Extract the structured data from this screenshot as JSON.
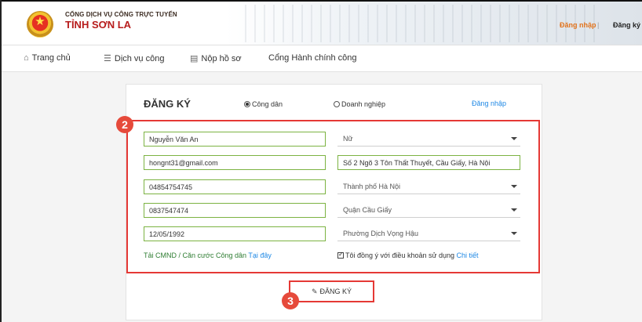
{
  "header": {
    "brand_line1": "CỔNG DỊCH VỤ CÔNG TRỰC TUYẾN",
    "brand_line2": "TỈNH SƠN LA",
    "login": "Đăng nhập",
    "separator": "|",
    "register": "Đăng ký"
  },
  "nav": [
    {
      "label": "Trang chủ",
      "icon": "home-icon",
      "glyph": "⌂"
    },
    {
      "label": "Dịch vụ công",
      "icon": "list-icon",
      "glyph": "☰"
    },
    {
      "label": "Nộp hồ sơ",
      "icon": "document-icon",
      "glyph": "▤"
    },
    {
      "label": "Cổng Hành chính công",
      "icon": "",
      "glyph": ""
    }
  ],
  "form": {
    "title": "ĐĂNG KÝ",
    "radio_citizen": "Công dân",
    "radio_business": "Doanh nghiệp",
    "radio_selected": "Công dân",
    "login_link": "Đăng nhập",
    "full_name": "Nguyễn Văn An",
    "email": "hongnt31@gmail.com",
    "id_number": "04854754745",
    "phone": "0837547474",
    "birth_date": "12/05/1992",
    "gender": "Nữ",
    "address": "Số 2 Ngõ 3 Tôn Thất Thuyết, Cầu Giấy, Hà Nội",
    "province": "Thành phố Hà Nội",
    "district": "Quận Cầu Giấy",
    "ward": "Phường Dịch Vọng Hậu",
    "upload_text": "Tải CMND / Căn cước Công dân",
    "upload_link": "Tại đây",
    "agree_text": "Tôi đồng ý với điều khoản sử dụng",
    "agree_link": "Chi tiết",
    "submit_label": "ĐĂNG KÝ"
  },
  "annotations": {
    "step_form": "2",
    "step_submit": "3",
    "highlight_color": "#e53935"
  },
  "colors": {
    "brand_red": "#b71c1c",
    "login_orange": "#e2731c",
    "link_blue": "#1e88e5",
    "field_border_green": "#7cb342"
  }
}
